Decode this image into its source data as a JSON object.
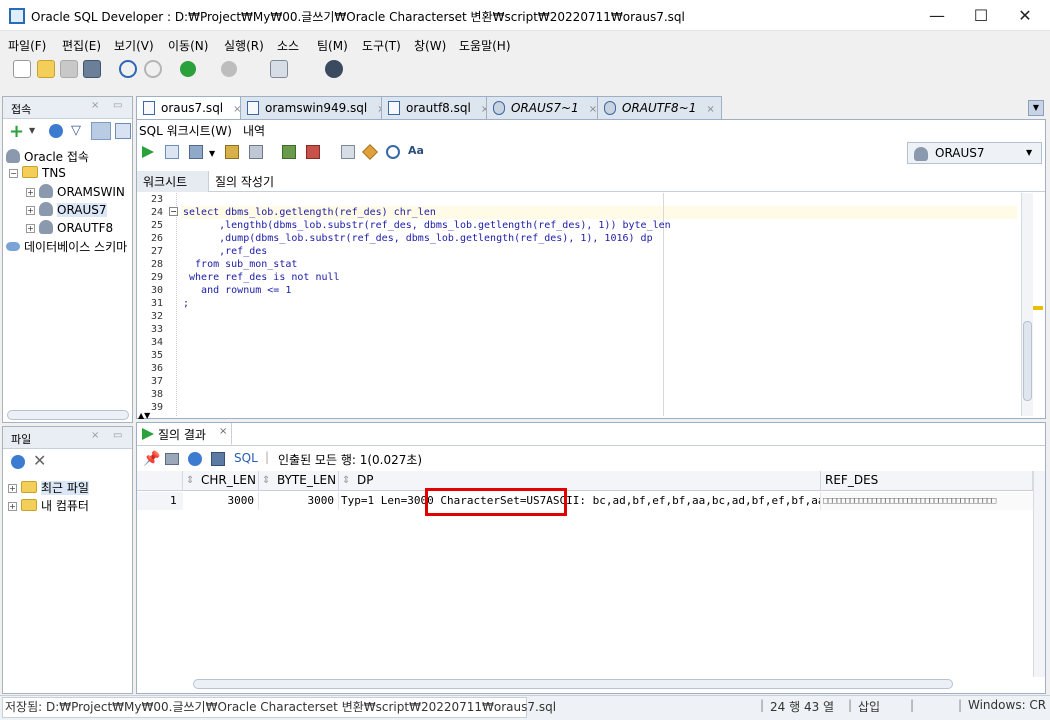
{
  "window": {
    "title": "Oracle SQL Developer : D:₩Project₩My₩00.글쓰기₩Oracle Characterset 변환₩script₩20220711₩oraus7.sql",
    "minimize": "—",
    "maximize": "☐",
    "close": "✕"
  },
  "menu": [
    "파일(F)",
    "편집(E)",
    "보기(V)",
    "이동(N)",
    "실행(R)",
    "소스",
    "팀(M)",
    "도구(T)",
    "창(W)",
    "도움말(H)"
  ],
  "connections": {
    "tab_label": "접속",
    "root": "Oracle 접속",
    "tns": "TNS",
    "items": [
      "ORAMSWIN",
      "ORAUS7",
      "ORAUTF8"
    ],
    "db_schema": "데이터베이스 스키마"
  },
  "files": {
    "tab_label": "파일",
    "items": [
      "최근 파일",
      "내 컴퓨터"
    ]
  },
  "doc_tabs": [
    "oraus7.sql",
    "oramswin949.sql",
    "orautf8.sql",
    "ORAUS7~1",
    "ORAUTF8~1"
  ],
  "worksheet": {
    "subtab_sql": "SQL 워크시트(W)",
    "subtab_history": "내역",
    "inner_tab_ws": "워크시트",
    "inner_tab_qb": "질의 작성기",
    "connection": "ORAUS7"
  },
  "editor": {
    "line_numbers": [
      "23",
      "24",
      "25",
      "26",
      "27",
      "28",
      "29",
      "30",
      "31",
      "32",
      "33",
      "34",
      "35",
      "36",
      "37",
      "38",
      "39"
    ],
    "lines": [
      "",
      "select dbms_lob.getlength(ref_des) chr_len",
      "      ,lengthb(dbms_lob.substr(ref_des, dbms_lob.getlength(ref_des), 1)) byte_len",
      "      ,dump(dbms_lob.substr(ref_des, dbms_lob.getlength(ref_des), 1), 1016) dp",
      "      ,ref_des",
      "  from sub_mon_stat",
      " where ref_des is not null",
      "   and rownum <= 1",
      ";",
      "",
      "",
      "",
      "",
      "",
      "",
      "",
      ""
    ]
  },
  "results": {
    "tab_label": "질의 결과",
    "sql_label": "SQL",
    "status": "인출된 모든 행: 1(0.027초)",
    "columns": [
      "CHR_LEN",
      "BYTE_LEN",
      "DP",
      "REF_DES"
    ],
    "rows": [
      {
        "num": "1",
        "chr_len": "3000",
        "byte_len": "3000",
        "dp_prefix": "Typ=1 Len=3000",
        "dp_charset": "CharacterSet=US7ASCII:",
        "dp_rest": "bc,ad,bf,ef,bf,aa,bc,ad,bf,ef,bf,aa,bc,...",
        "ref_des": "□□□□□□□□□□□□□□□□□□□□□□□□□□□□□□□□□□□□□□□"
      }
    ],
    "highlight_color": "#e00000"
  },
  "statusbar": {
    "path": "저장됨: D:₩Project₩My₩00.글쓰기₩Oracle Characterset 변환₩script₩20220711₩oraus7.sql",
    "position": "24 행 43 열",
    "mode": "삽입",
    "eol": "Windows: CR"
  }
}
